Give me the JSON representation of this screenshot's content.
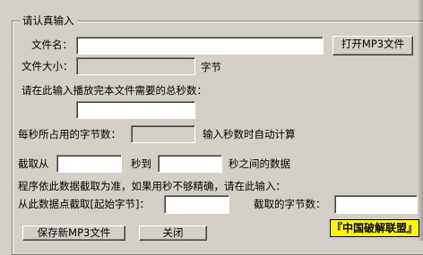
{
  "group_title": "请认真输入",
  "file": {
    "name_label": "文件名：",
    "name_value": "",
    "open_button": "打开MP3文件",
    "size_label": "文件大小：",
    "size_value": "",
    "size_unit": "字节"
  },
  "seconds": {
    "total_prompt": "请在此输入播放完本文件需要的总秒数：",
    "total_value": "",
    "bytes_per_sec_label": "每秒所占用的字节数：",
    "bytes_per_sec_value": "",
    "auto_calc_note": "输入秒数时自动计算"
  },
  "range": {
    "from_label": "截取从",
    "from_value": "",
    "sec_to": "秒到",
    "to_value": "",
    "between_note": "秒之间的数据"
  },
  "precision": {
    "note": "程序依此数据截取为准，如果用秒不够精确，请在此输入：",
    "start_label": "从此数据点截取[起始字节]：",
    "start_value": "",
    "length_label": "截取的字节数：",
    "length_value": ""
  },
  "buttons": {
    "save": "保存新MP3文件",
    "close": "关闭"
  },
  "watermark": "『中国破解联盟』"
}
